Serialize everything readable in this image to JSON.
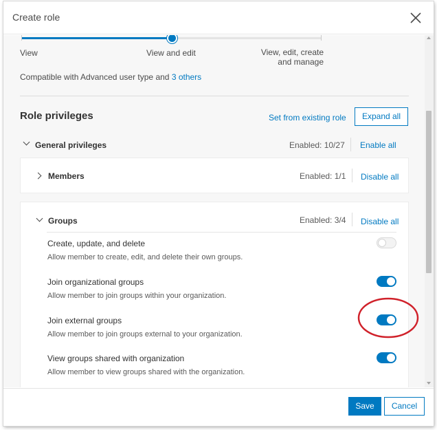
{
  "dialog": {
    "title": "Create role",
    "close_icon": "close-icon"
  },
  "slider": {
    "labels": [
      "View",
      "View and edit",
      "View, edit, create",
      "and manage"
    ],
    "level": "View and edit"
  },
  "compat": {
    "text": "Compatible with Advanced user type and ",
    "link": "3 others"
  },
  "privileges": {
    "title": "Role privileges",
    "set_from_existing": "Set from existing role",
    "expand_all": "Expand all",
    "general": {
      "label": "General privileges",
      "enabled": "Enabled: 10/27",
      "action": "Enable all"
    },
    "members": {
      "label": "Members",
      "enabled": "Enabled: 1/1",
      "action": "Disable all"
    },
    "groups": {
      "label": "Groups",
      "enabled": "Enabled: 3/4",
      "action": "Disable all",
      "items": [
        {
          "title": "Create, update, and delete",
          "desc": "Allow member to create, edit, and delete their own groups.",
          "enabled": false
        },
        {
          "title": "Join organizational groups",
          "desc": "Allow member to join groups within your organization.",
          "enabled": true
        },
        {
          "title": "Join external groups",
          "desc": "Allow member to join groups external to your organization.",
          "enabled": true
        },
        {
          "title": "View groups shared with organization",
          "desc": "Allow member to view groups shared with the organization.",
          "enabled": true
        }
      ]
    }
  },
  "footer": {
    "save": "Save",
    "cancel": "Cancel"
  },
  "colors": {
    "accent": "#0079c1",
    "annotation": "#d0212a"
  }
}
